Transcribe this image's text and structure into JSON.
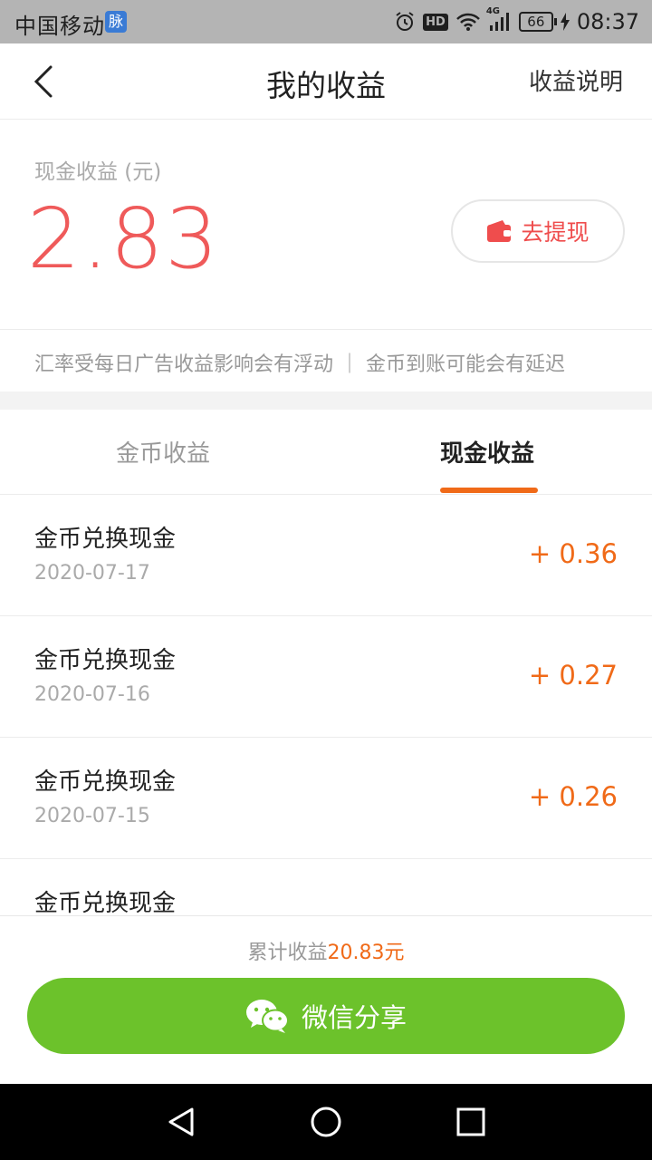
{
  "status_bar": {
    "carrier": "中国移动",
    "carrier_badge": "脉",
    "hd": "HD",
    "network": "4G",
    "battery": "66",
    "time": "08:37"
  },
  "header": {
    "title": "我的收益",
    "right_link": "收益说明"
  },
  "balance": {
    "label": "现金收益 (元)",
    "amount": "2.83",
    "withdraw_label": "去提现"
  },
  "notice": "汇率受每日广告收益影响会有浮动 ｜ 金币到账可能会有延迟",
  "tabs": [
    {
      "label": "金币收益",
      "active": false
    },
    {
      "label": "现金收益",
      "active": true
    }
  ],
  "records": [
    {
      "title": "金币兑换现金",
      "date": "2020-07-17",
      "amount": "+ 0.36"
    },
    {
      "title": "金币兑换现金",
      "date": "2020-07-16",
      "amount": "+ 0.27"
    },
    {
      "title": "金币兑换现金",
      "date": "2020-07-15",
      "amount": "+ 0.26"
    },
    {
      "title": "金币兑换现金",
      "date": "",
      "amount": ""
    }
  ],
  "footer": {
    "total_prefix": "累计收益",
    "total_value": "20.83元",
    "share_label": "微信分享"
  },
  "colors": {
    "accent_red": "#ef5a5a",
    "accent_orange": "#f06a18",
    "share_green": "#6cc22b"
  }
}
